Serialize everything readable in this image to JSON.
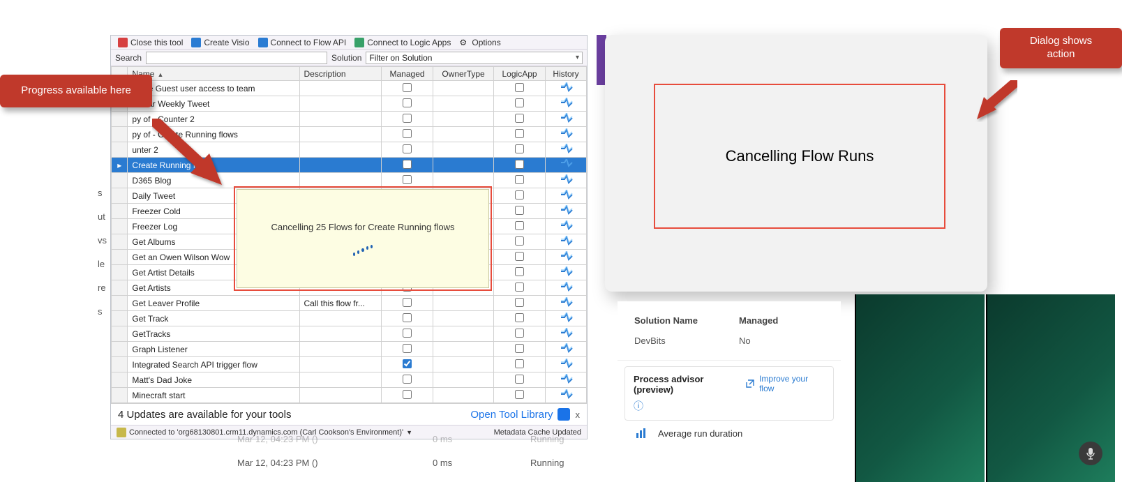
{
  "callouts": {
    "left": "Progress available here",
    "right": "Dialog shows\naction"
  },
  "toolbar": {
    "close": "Close this tool",
    "visio": "Create Visio",
    "flowapi": "Connect to Flow API",
    "logicapps": "Connect to Logic Apps",
    "options": "Options"
  },
  "filterbar": {
    "search_label": "Search",
    "search_value": "",
    "solution_label": "Solution",
    "solution_value": "Filter on Solution"
  },
  "grid": {
    "columns": {
      "name": "Name",
      "desc": "Description",
      "managed": "Managed",
      "owner": "OwnerType",
      "logicapp": "LogicApp",
      "history": "History"
    },
    "rows": [
      {
        "name": "prove Guest user access to team",
        "desc": "",
        "managed": false,
        "logicapp": false
      },
      {
        "name": "lendar Weekly Tweet",
        "desc": "",
        "managed": false,
        "logicapp": false
      },
      {
        "name": "py of - Counter 2",
        "desc": "",
        "managed": false,
        "logicapp": false
      },
      {
        "name": "py of - Create Running flows",
        "desc": "",
        "managed": false,
        "logicapp": false
      },
      {
        "name": "unter 2",
        "desc": "",
        "managed": false,
        "logicapp": false
      },
      {
        "name": "Create Running flows",
        "desc": "",
        "managed": false,
        "logicapp": false,
        "selected": true,
        "rowmark": "▸"
      },
      {
        "name": "D365 Blog",
        "desc": "",
        "managed": false,
        "logicapp": false
      },
      {
        "name": "Daily Tweet",
        "desc": "",
        "managed": false,
        "logicapp": false
      },
      {
        "name": "Freezer Cold",
        "desc": "",
        "managed": false,
        "logicapp": false
      },
      {
        "name": "Freezer Log",
        "desc": "",
        "managed": false,
        "logicapp": false
      },
      {
        "name": "Get Albums",
        "desc": "",
        "managed": false,
        "logicapp": false
      },
      {
        "name": "Get an Owen Wilson Wow",
        "desc": "",
        "managed": false,
        "logicapp": false
      },
      {
        "name": "Get Artist Details",
        "desc": "",
        "managed": false,
        "logicapp": false
      },
      {
        "name": "Get Artists",
        "desc": "",
        "managed": false,
        "logicapp": false
      },
      {
        "name": "Get Leaver Profile",
        "desc": "Call this flow fr...",
        "managed": false,
        "logicapp": false
      },
      {
        "name": "Get Track",
        "desc": "",
        "managed": false,
        "logicapp": false
      },
      {
        "name": "GetTracks",
        "desc": "",
        "managed": false,
        "logicapp": false
      },
      {
        "name": "Graph Listener",
        "desc": "",
        "managed": false,
        "logicapp": false
      },
      {
        "name": "Integrated Search API trigger flow",
        "desc": "",
        "managed": true,
        "logicapp": false
      },
      {
        "name": "Matt's Dad Joke",
        "desc": "",
        "managed": false,
        "logicapp": false
      },
      {
        "name": "Minecraft start",
        "desc": "",
        "managed": false,
        "logicapp": false
      }
    ]
  },
  "tooltip": "Cancelling 25 Flows for Create Running flows",
  "updates_bar": {
    "text": "4 Updates are available for your tools",
    "open_label": "Open Tool Library",
    "close_label": "x"
  },
  "status_bar": {
    "connected": "Connected to 'org68130801.crm11.dynamics.com (Carl Cookson's Environment)'",
    "cache": "Metadata Cache Updated"
  },
  "side_sliver_labels": [
    "s",
    "ut",
    "vs",
    "le",
    "re",
    "s"
  ],
  "dialog_title": "Cancelling Flow Runs",
  "solutions": {
    "header_name": "Solution Name",
    "header_managed": "Managed",
    "row_name": "DevBits",
    "row_managed": "No"
  },
  "process_advisor": {
    "title": "Process advisor (preview)",
    "improve_label": "Improve your flow",
    "avg_label": "Average run duration"
  },
  "run_history": {
    "rows": [
      {
        "ts": "Mar 12, 04:23 PM ()",
        "dur": "0 ms",
        "status": "Running"
      },
      {
        "ts": "Mar 12, 04:23 PM ()",
        "dur": "0 ms",
        "status": "Running"
      }
    ]
  }
}
